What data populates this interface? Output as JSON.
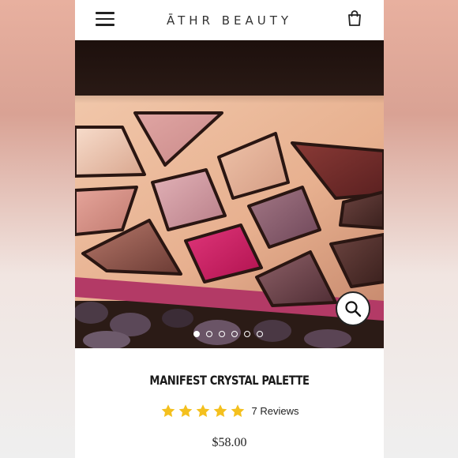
{
  "header": {
    "brand": "ĀTHR BEAUTY"
  },
  "gallery": {
    "total_images": 6,
    "active_index": 0
  },
  "product": {
    "title": "MANIFEST CRYSTAL PALETTE",
    "rating": 5,
    "max_rating": 5,
    "reviews_label": "7 Reviews",
    "price": "$58.00"
  },
  "colors": {
    "star": "#f4c01e",
    "page": "#ffffff",
    "palette_case": "#e7b595"
  },
  "icons": {
    "menu": "hamburger-icon",
    "cart": "shopping-bag-icon",
    "zoom": "magnifier-icon",
    "star": "star-icon"
  }
}
